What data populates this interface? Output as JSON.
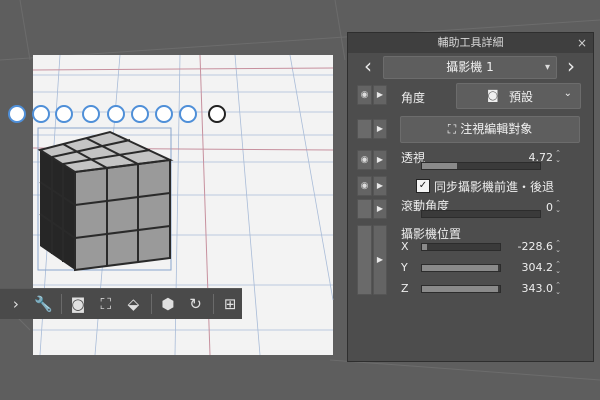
{
  "colors": {
    "canvas_bg": "#5a5a5a",
    "floor": "#f0f0f0",
    "grid_blue": "#9fb3d1",
    "grid_red": "#c99aa6",
    "accent_handle": "#4f8fd8",
    "panel_bg": "#4d4d4d"
  },
  "manipulator_icons": [
    "rotate-camera-icon",
    "move-camera-icon",
    "move-camera-forward-icon",
    "move-object-icon",
    "rotate-object-icon",
    "rotate-object-2-icon",
    "move-plane-icon",
    "rotate-plane-icon",
    "reset-rotation-icon"
  ],
  "toolbar": {
    "icons": [
      "chevron-right-icon",
      "wrench-icon",
      "camera-icon",
      "focus-icon",
      "floor-icon",
      "object-view-icon",
      "rotate-view-icon",
      "layout-icon"
    ]
  },
  "palette": {
    "title": "輔助工具詳細",
    "close_glyph": "×",
    "subtool_name": "攝影機 1",
    "prev_glyph": "‹",
    "next_glyph": "›",
    "angle_label": "角度",
    "angle_value": "預設",
    "edit_target_button": "注視編輯對象",
    "perspective_label": "透視",
    "perspective_value": "4.72",
    "perspective_level": 0.3,
    "sync_label": "同步攝影機前進・後退",
    "sync_checked": "✓",
    "roll_label": "滾動角度",
    "roll_value": "0",
    "roll_level": 0.0,
    "position_label": "攝影機位置",
    "x_label": "X",
    "x_value": "-228.6",
    "x_level": 0.06,
    "y_label": "Y",
    "y_value": "304.2",
    "y_level": 0.97,
    "z_label": "Z",
    "z_value": "343.0",
    "z_level": 0.97
  }
}
